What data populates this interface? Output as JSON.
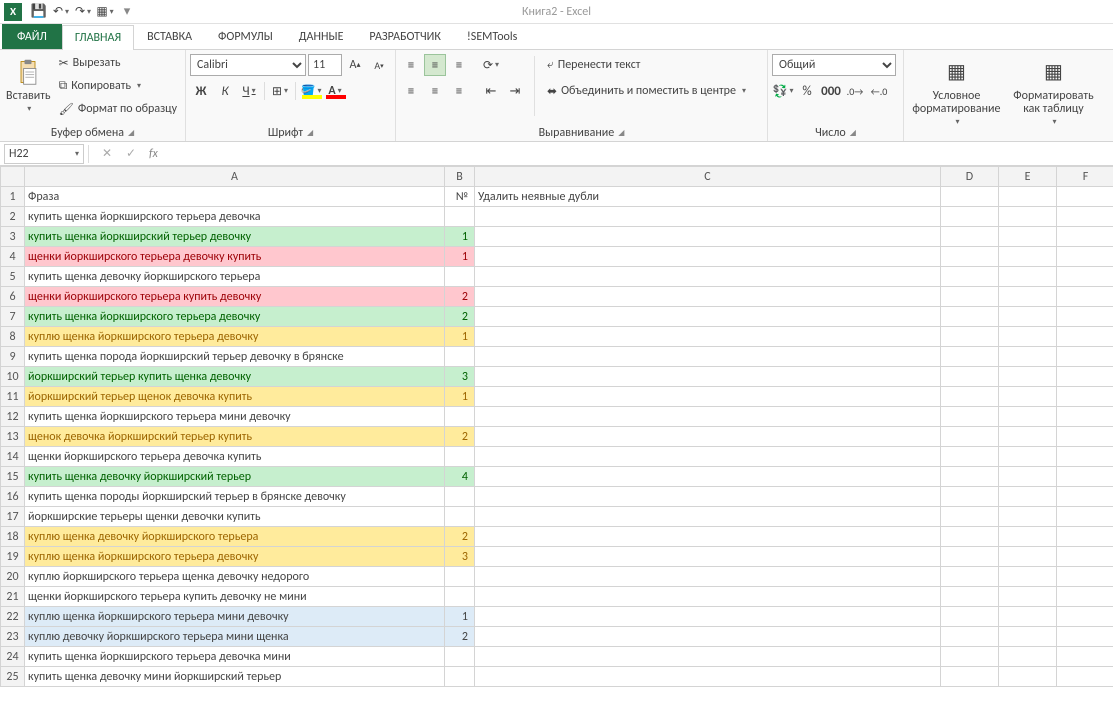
{
  "title": "Книга2 - Excel",
  "qat": {
    "save": "💾",
    "undo": "↶",
    "redo": "↷",
    "custom": "▦"
  },
  "tabs": {
    "file": "ФАЙЛ",
    "home": "ГЛАВНАЯ",
    "insert": "ВСТАВКА",
    "formulas": "ФОРМУЛЫ",
    "data": "ДАННЫЕ",
    "developer": "РАЗРАБОТЧИК",
    "semtools": "!SEMTools"
  },
  "ribbon": {
    "clipboard": {
      "paste": "Вставить",
      "cut": "Вырезать",
      "copy": "Копировать",
      "painter": "Формат по образцу",
      "label": "Буфер обмена"
    },
    "font": {
      "name": "Calibri",
      "size": "11",
      "label": "Шрифт"
    },
    "align": {
      "wrap": "Перенести текст",
      "merge": "Объединить и поместить в центре",
      "label": "Выравнивание"
    },
    "number": {
      "format": "Общий",
      "label": "Число"
    },
    "styles": {
      "cond": "Условное форматирование",
      "table": "Форматировать как таблицу",
      "label": ""
    }
  },
  "namebox": "H22",
  "headers": {
    "A": "A",
    "B": "B",
    "C": "C",
    "D": "D",
    "E": "E",
    "F": "F"
  },
  "row1": {
    "A": "Фраза",
    "B": "№",
    "C": "Удалить неявные дубли"
  },
  "rows": [
    {
      "n": 2,
      "a": "купить щенка йоркширского терьера девочка",
      "b": "",
      "cls": ""
    },
    {
      "n": 3,
      "a": "купить щенка йоркширский терьер девочку",
      "b": "1",
      "cls": "c-green",
      "tc": "t-green"
    },
    {
      "n": 4,
      "a": "щенки йоркширского терьера девочку купить",
      "b": "1",
      "cls": "c-red",
      "tc": "t-red"
    },
    {
      "n": 5,
      "a": "купить щенка девочку йоркширского терьера",
      "b": "",
      "cls": ""
    },
    {
      "n": 6,
      "a": "щенки йоркширского терьера купить девочку",
      "b": "2",
      "cls": "c-red",
      "tc": "t-red"
    },
    {
      "n": 7,
      "a": "купить щенка йоркширского терьера девочку",
      "b": "2",
      "cls": "c-green",
      "tc": "t-green"
    },
    {
      "n": 8,
      "a": "куплю щенка йоркширского терьера девочку",
      "b": "1",
      "cls": "c-yellow",
      "tc": "t-brown"
    },
    {
      "n": 9,
      "a": "купить щенка порода йоркширский терьер девочку в брянске",
      "b": "",
      "cls": ""
    },
    {
      "n": 10,
      "a": "йоркширский терьер купить щенка девочку",
      "b": "3",
      "cls": "c-green",
      "tc": "t-green"
    },
    {
      "n": 11,
      "a": "йоркширский терьер щенок девочка купить",
      "b": "1",
      "cls": "c-yellow",
      "tc": "t-brown"
    },
    {
      "n": 12,
      "a": "купить щенка йоркширского терьера мини девочку",
      "b": "",
      "cls": ""
    },
    {
      "n": 13,
      "a": "щенок девочка йоркширский терьер купить",
      "b": "2",
      "cls": "c-yellow",
      "tc": "t-brown"
    },
    {
      "n": 14,
      "a": "щенки йоркширского терьера девочка купить",
      "b": "",
      "cls": ""
    },
    {
      "n": 15,
      "a": "купить щенка девочку йоркширский терьер",
      "b": "4",
      "cls": "c-green",
      "tc": "t-green"
    },
    {
      "n": 16,
      "a": "купить щенка породы йоркширский терьер в брянске девочку",
      "b": "",
      "cls": ""
    },
    {
      "n": 17,
      "a": "йоркширские терьеры щенки девочки купить",
      "b": "",
      "cls": ""
    },
    {
      "n": 18,
      "a": "куплю щенка девочку йоркширского терьера",
      "b": "2",
      "cls": "c-yellow",
      "tc": "t-brown"
    },
    {
      "n": 19,
      "a": "куплю щенка йоркширского терьера девочку",
      "b": "3",
      "cls": "c-yellow",
      "tc": "t-brown"
    },
    {
      "n": 20,
      "a": "куплю йоркширского терьера щенка девочку недорого",
      "b": "",
      "cls": ""
    },
    {
      "n": 21,
      "a": "щенки йоркширского терьера купить девочку не мини",
      "b": "",
      "cls": ""
    },
    {
      "n": 22,
      "a": "куплю щенка йоркширского терьера мини девочку",
      "b": "1",
      "cls": "c-blue"
    },
    {
      "n": 23,
      "a": "куплю девочку йоркширского терьера мини щенка",
      "b": "2",
      "cls": "c-blue"
    },
    {
      "n": 24,
      "a": "купить щенка йоркширского терьера девочка мини",
      "b": "",
      "cls": ""
    },
    {
      "n": 25,
      "a": "купить щенка девочку мини йоркширский терьер",
      "b": "",
      "cls": ""
    }
  ]
}
